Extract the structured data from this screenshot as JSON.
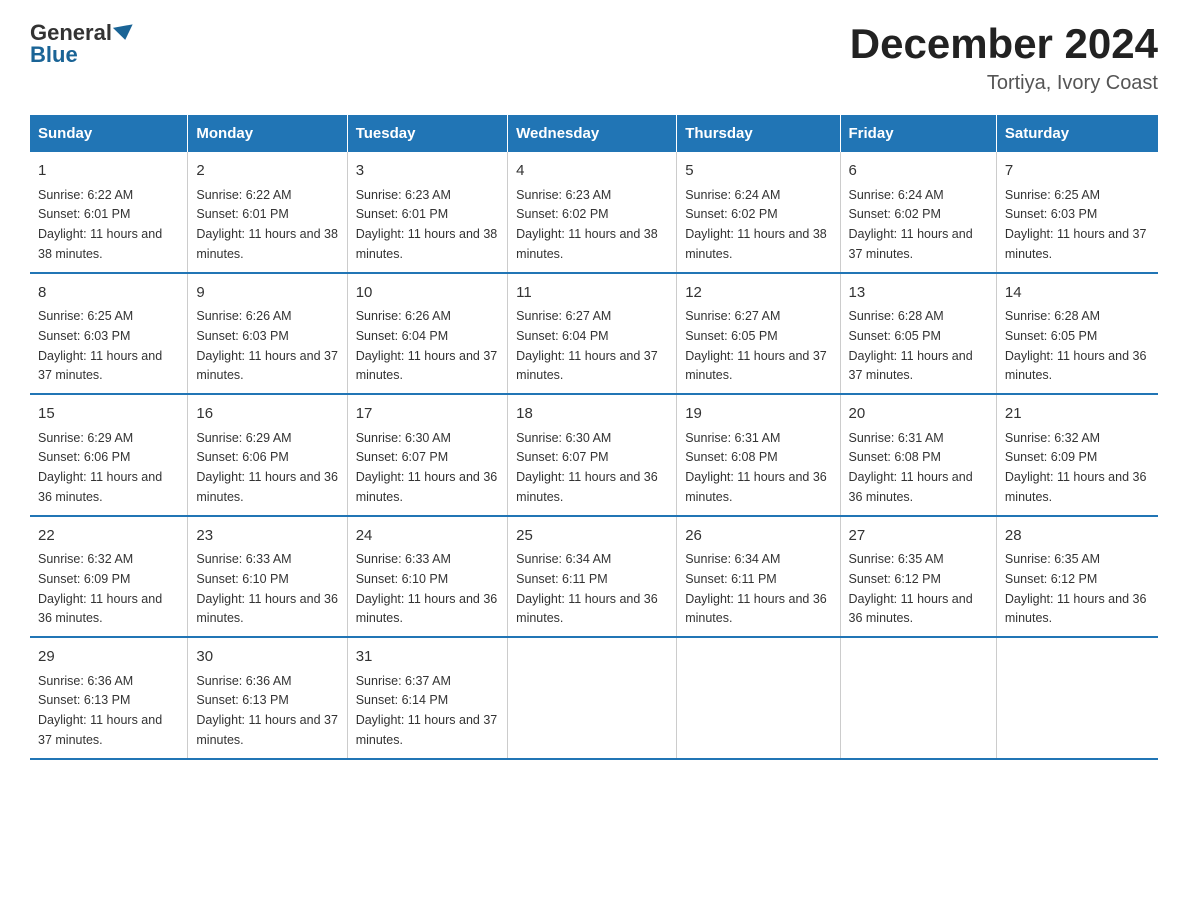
{
  "logo": {
    "general": "General",
    "blue": "Blue"
  },
  "title": "December 2024",
  "subtitle": "Tortiya, Ivory Coast",
  "weekdays": [
    "Sunday",
    "Monday",
    "Tuesday",
    "Wednesday",
    "Thursday",
    "Friday",
    "Saturday"
  ],
  "weeks": [
    [
      {
        "day": "1",
        "sunrise": "6:22 AM",
        "sunset": "6:01 PM",
        "daylight": "11 hours and 38 minutes."
      },
      {
        "day": "2",
        "sunrise": "6:22 AM",
        "sunset": "6:01 PM",
        "daylight": "11 hours and 38 minutes."
      },
      {
        "day": "3",
        "sunrise": "6:23 AM",
        "sunset": "6:01 PM",
        "daylight": "11 hours and 38 minutes."
      },
      {
        "day": "4",
        "sunrise": "6:23 AM",
        "sunset": "6:02 PM",
        "daylight": "11 hours and 38 minutes."
      },
      {
        "day": "5",
        "sunrise": "6:24 AM",
        "sunset": "6:02 PM",
        "daylight": "11 hours and 38 minutes."
      },
      {
        "day": "6",
        "sunrise": "6:24 AM",
        "sunset": "6:02 PM",
        "daylight": "11 hours and 37 minutes."
      },
      {
        "day": "7",
        "sunrise": "6:25 AM",
        "sunset": "6:03 PM",
        "daylight": "11 hours and 37 minutes."
      }
    ],
    [
      {
        "day": "8",
        "sunrise": "6:25 AM",
        "sunset": "6:03 PM",
        "daylight": "11 hours and 37 minutes."
      },
      {
        "day": "9",
        "sunrise": "6:26 AM",
        "sunset": "6:03 PM",
        "daylight": "11 hours and 37 minutes."
      },
      {
        "day": "10",
        "sunrise": "6:26 AM",
        "sunset": "6:04 PM",
        "daylight": "11 hours and 37 minutes."
      },
      {
        "day": "11",
        "sunrise": "6:27 AM",
        "sunset": "6:04 PM",
        "daylight": "11 hours and 37 minutes."
      },
      {
        "day": "12",
        "sunrise": "6:27 AM",
        "sunset": "6:05 PM",
        "daylight": "11 hours and 37 minutes."
      },
      {
        "day": "13",
        "sunrise": "6:28 AM",
        "sunset": "6:05 PM",
        "daylight": "11 hours and 37 minutes."
      },
      {
        "day": "14",
        "sunrise": "6:28 AM",
        "sunset": "6:05 PM",
        "daylight": "11 hours and 36 minutes."
      }
    ],
    [
      {
        "day": "15",
        "sunrise": "6:29 AM",
        "sunset": "6:06 PM",
        "daylight": "11 hours and 36 minutes."
      },
      {
        "day": "16",
        "sunrise": "6:29 AM",
        "sunset": "6:06 PM",
        "daylight": "11 hours and 36 minutes."
      },
      {
        "day": "17",
        "sunrise": "6:30 AM",
        "sunset": "6:07 PM",
        "daylight": "11 hours and 36 minutes."
      },
      {
        "day": "18",
        "sunrise": "6:30 AM",
        "sunset": "6:07 PM",
        "daylight": "11 hours and 36 minutes."
      },
      {
        "day": "19",
        "sunrise": "6:31 AM",
        "sunset": "6:08 PM",
        "daylight": "11 hours and 36 minutes."
      },
      {
        "day": "20",
        "sunrise": "6:31 AM",
        "sunset": "6:08 PM",
        "daylight": "11 hours and 36 minutes."
      },
      {
        "day": "21",
        "sunrise": "6:32 AM",
        "sunset": "6:09 PM",
        "daylight": "11 hours and 36 minutes."
      }
    ],
    [
      {
        "day": "22",
        "sunrise": "6:32 AM",
        "sunset": "6:09 PM",
        "daylight": "11 hours and 36 minutes."
      },
      {
        "day": "23",
        "sunrise": "6:33 AM",
        "sunset": "6:10 PM",
        "daylight": "11 hours and 36 minutes."
      },
      {
        "day": "24",
        "sunrise": "6:33 AM",
        "sunset": "6:10 PM",
        "daylight": "11 hours and 36 minutes."
      },
      {
        "day": "25",
        "sunrise": "6:34 AM",
        "sunset": "6:11 PM",
        "daylight": "11 hours and 36 minutes."
      },
      {
        "day": "26",
        "sunrise": "6:34 AM",
        "sunset": "6:11 PM",
        "daylight": "11 hours and 36 minutes."
      },
      {
        "day": "27",
        "sunrise": "6:35 AM",
        "sunset": "6:12 PM",
        "daylight": "11 hours and 36 minutes."
      },
      {
        "day": "28",
        "sunrise": "6:35 AM",
        "sunset": "6:12 PM",
        "daylight": "11 hours and 36 minutes."
      }
    ],
    [
      {
        "day": "29",
        "sunrise": "6:36 AM",
        "sunset": "6:13 PM",
        "daylight": "11 hours and 37 minutes."
      },
      {
        "day": "30",
        "sunrise": "6:36 AM",
        "sunset": "6:13 PM",
        "daylight": "11 hours and 37 minutes."
      },
      {
        "day": "31",
        "sunrise": "6:37 AM",
        "sunset": "6:14 PM",
        "daylight": "11 hours and 37 minutes."
      },
      {
        "day": "",
        "sunrise": "",
        "sunset": "",
        "daylight": ""
      },
      {
        "day": "",
        "sunrise": "",
        "sunset": "",
        "daylight": ""
      },
      {
        "day": "",
        "sunrise": "",
        "sunset": "",
        "daylight": ""
      },
      {
        "day": "",
        "sunrise": "",
        "sunset": "",
        "daylight": ""
      }
    ]
  ]
}
